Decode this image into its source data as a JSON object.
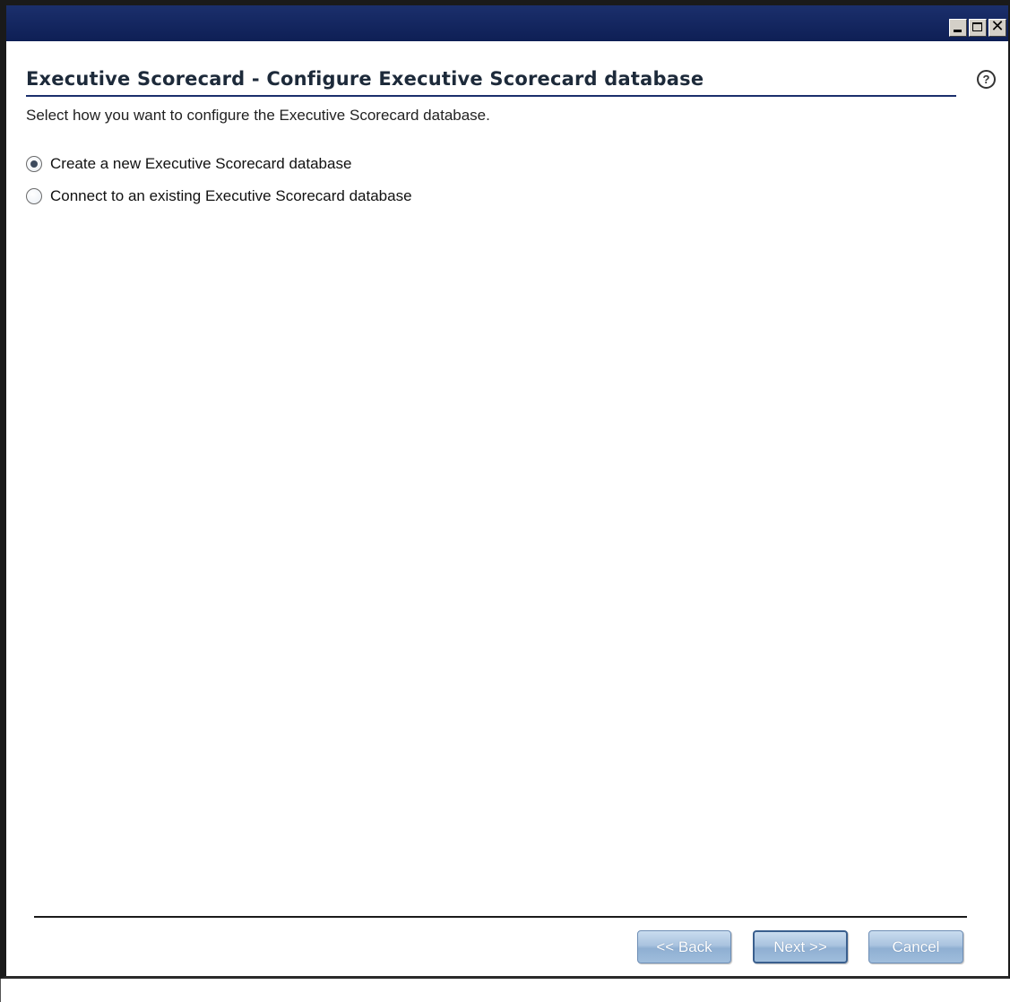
{
  "window": {
    "controls": [
      "minimize-icon",
      "maximize-icon",
      "close-icon"
    ],
    "close_glyph": "✕"
  },
  "header": {
    "title": "Executive Scorecard - Configure Executive Scorecard database",
    "help_glyph": "?"
  },
  "main": {
    "instruction": "Select how you want to configure the Executive Scorecard database.",
    "options": [
      {
        "label": "Create a new Executive Scorecard database",
        "selected": true
      },
      {
        "label": "Connect to an existing Executive Scorecard database",
        "selected": false
      }
    ]
  },
  "footer": {
    "back_label": "<< Back",
    "next_label": "Next >>",
    "cancel_label": "Cancel"
  },
  "colors": {
    "titlebar": "#1b2f6c",
    "button_face": "#a9c3df",
    "button_text": "#ffffff"
  }
}
